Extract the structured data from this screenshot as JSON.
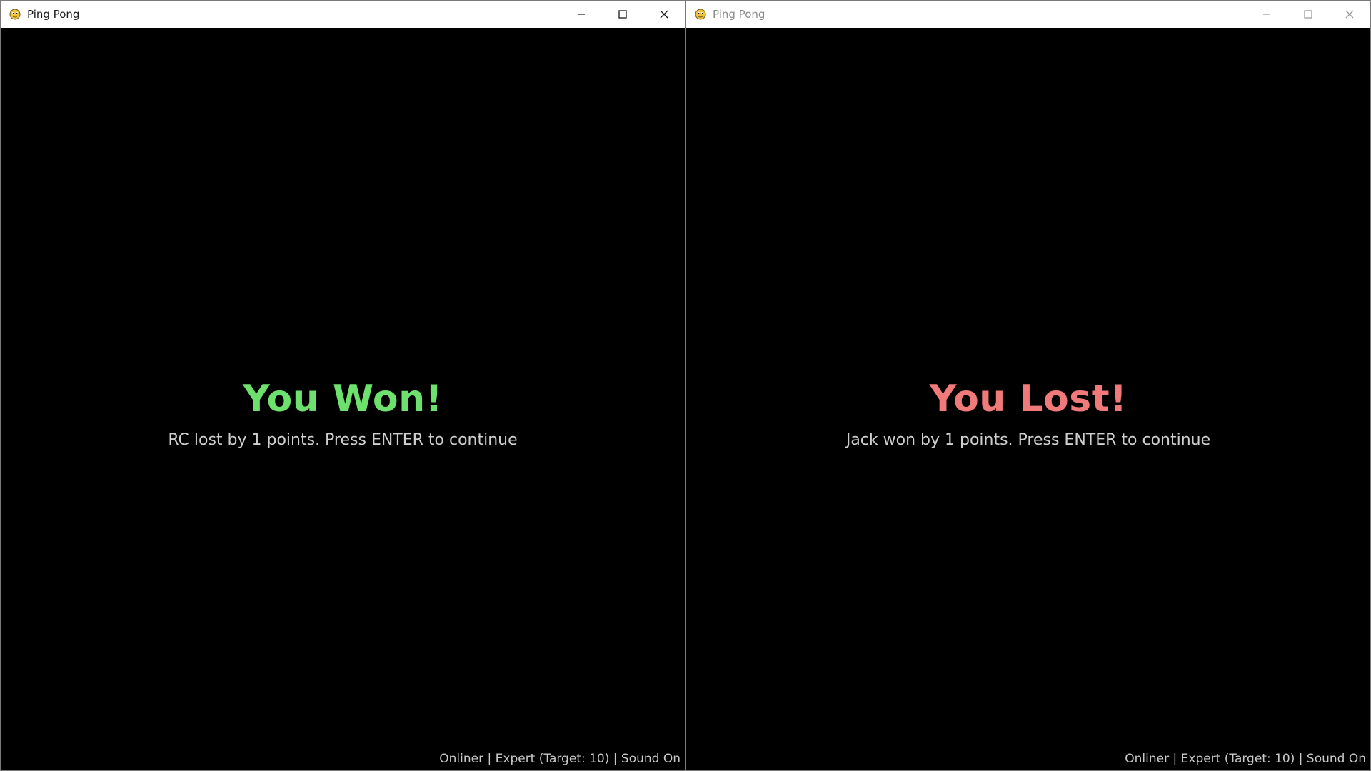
{
  "colors": {
    "win": "#6ee06e",
    "lose": "#f07a7a",
    "subtitle": "#cfcfcf",
    "status": "#c8c8c8"
  },
  "windows": [
    {
      "title": "Ping Pong",
      "active": true,
      "result_title": "You Won!",
      "result_message": "RC lost by 1 points. Press ENTER to continue",
      "status_bar": "Onliner | Expert (Target: 10) | Sound On"
    },
    {
      "title": "Ping Pong",
      "active": false,
      "result_title": "You Lost!",
      "result_message": "Jack won by 1 points. Press ENTER to continue",
      "status_bar": "Onliner | Expert (Target: 10) | Sound On"
    }
  ],
  "icons": {
    "app": "pygame-snake-icon",
    "minimize": "minimize-icon",
    "maximize": "maximize-icon",
    "close": "close-icon"
  }
}
